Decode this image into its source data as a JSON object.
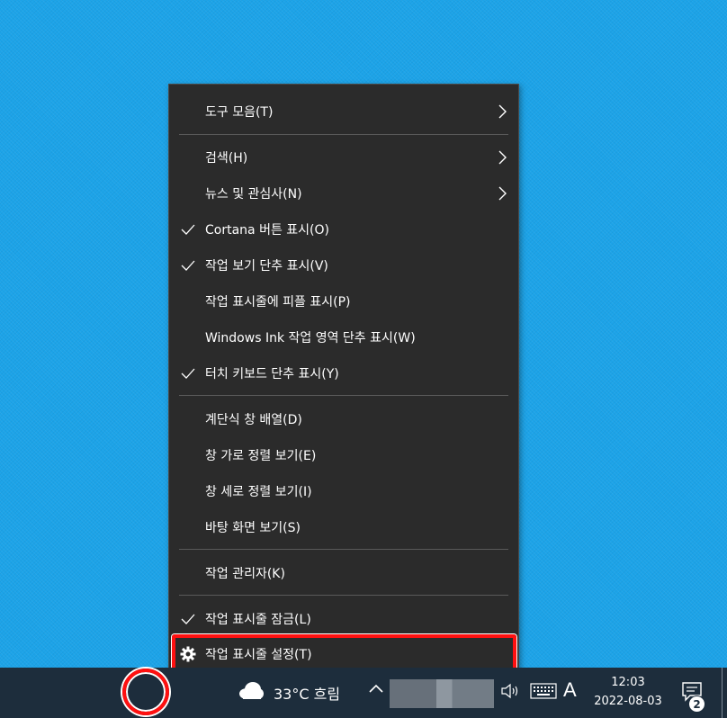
{
  "menu": {
    "items": [
      {
        "label": "도구 모음(T)",
        "checked": false,
        "submenu": true
      },
      {
        "label": "검색(H)",
        "checked": false,
        "submenu": true
      },
      {
        "label": "뉴스 및 관심사(N)",
        "checked": false,
        "submenu": true
      },
      {
        "label": "Cortana 버튼 표시(O)",
        "checked": true,
        "submenu": false
      },
      {
        "label": "작업 보기 단추 표시(V)",
        "checked": true,
        "submenu": false
      },
      {
        "label": "작업 표시줄에 피플 표시(P)",
        "checked": false,
        "submenu": false
      },
      {
        "label": "Windows Ink 작업 영역 단추 표시(W)",
        "checked": false,
        "submenu": false
      },
      {
        "label": "터치 키보드 단추 표시(Y)",
        "checked": true,
        "submenu": false
      },
      {
        "label": "계단식 창 배열(D)",
        "checked": false,
        "submenu": false
      },
      {
        "label": "창 가로 정렬 보기(E)",
        "checked": false,
        "submenu": false
      },
      {
        "label": "창 세로 정렬 보기(I)",
        "checked": false,
        "submenu": false
      },
      {
        "label": "바탕 화면 보기(S)",
        "checked": false,
        "submenu": false
      },
      {
        "label": "작업 관리자(K)",
        "checked": false,
        "submenu": false
      },
      {
        "label": "작업 표시줄 잠금(L)",
        "checked": true,
        "submenu": false
      },
      {
        "label": "작업 표시줄 설정(T)",
        "checked": false,
        "submenu": false,
        "icon": "gear-icon"
      }
    ]
  },
  "taskbar": {
    "weather": {
      "icon": "cloud-icon",
      "text": "33°C 흐림"
    },
    "ime": "A",
    "clock": {
      "time": "12:03",
      "date": "2022-08-03"
    },
    "notification_count": "2"
  },
  "colors": {
    "desktop": "#1ca3e8",
    "menu_bg": "#2b2b2b",
    "taskbar_bg": "#1d2d3c",
    "highlight": "#ff1010"
  }
}
